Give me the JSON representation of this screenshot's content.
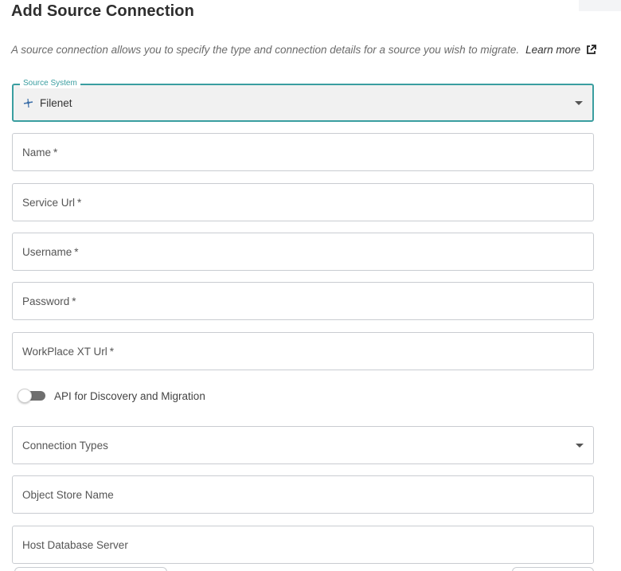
{
  "header": {
    "title": "Add Source Connection"
  },
  "description": {
    "text": "A source connection allows you to specify the type and connection details for a source you wish to migrate.",
    "learn_more": "Learn more",
    "learn_more_icon": "external-link-icon"
  },
  "source_system": {
    "legend": "Source System",
    "value": "Filenet",
    "icon": "filenet-logo-icon",
    "accent_color": "#3a9ea0"
  },
  "fields": {
    "name": {
      "label": "Name",
      "required": "*"
    },
    "service_url": {
      "label": "Service Url",
      "required": "*"
    },
    "username": {
      "label": "Username",
      "required": "*"
    },
    "password": {
      "label": "Password",
      "required": "*"
    },
    "workplace_xt_url": {
      "label": "WorkPlace XT Url",
      "required": "*"
    }
  },
  "api_toggle": {
    "label": "API for Discovery and Migration",
    "checked": false
  },
  "connection_types": {
    "placeholder": "Connection Types"
  },
  "object_store": {
    "label": "Object Store Name"
  },
  "host_db_server": {
    "label": "Host Database Server"
  }
}
